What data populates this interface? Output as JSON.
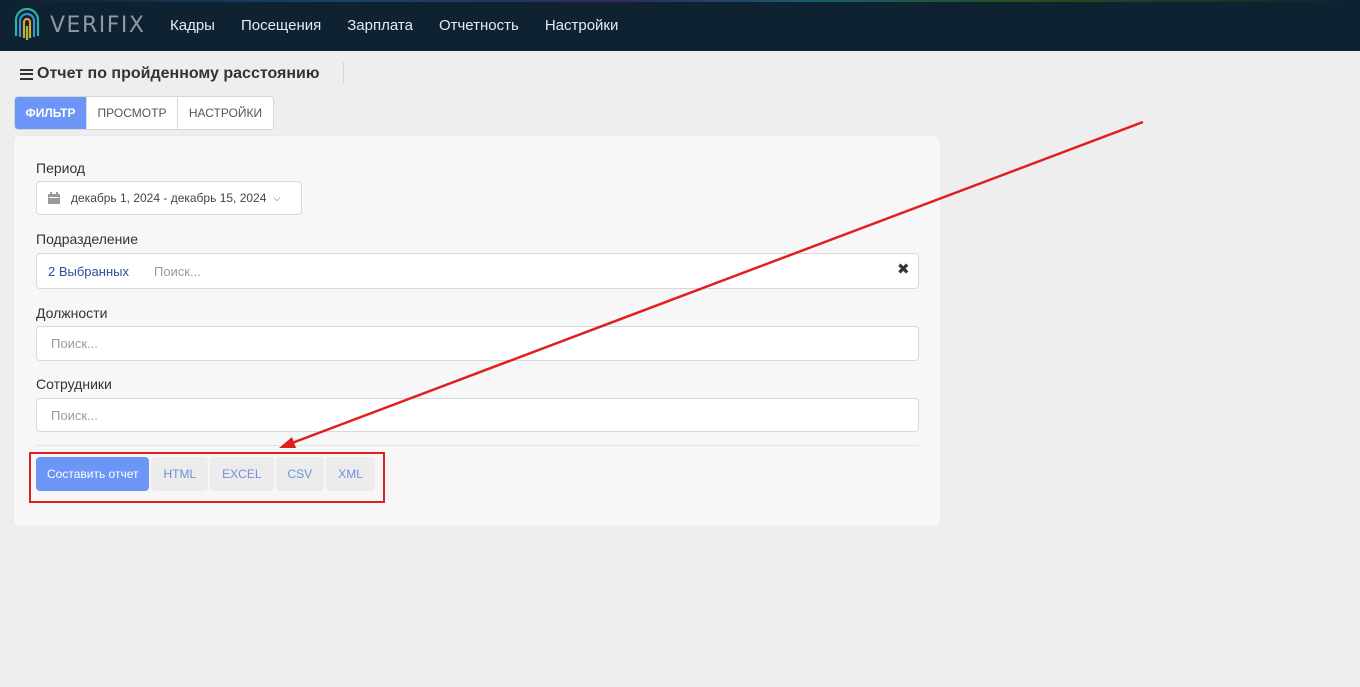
{
  "app": {
    "logo_text": "VERIFIX"
  },
  "nav": {
    "items": [
      {
        "label": "Кадры"
      },
      {
        "label": "Посещения"
      },
      {
        "label": "Зарплата"
      },
      {
        "label": "Отчетность"
      },
      {
        "label": "Настройки"
      }
    ]
  },
  "page": {
    "title": "Отчет по пройденному расстоянию"
  },
  "tabs": [
    {
      "label": "ФИЛЬТР",
      "active": true
    },
    {
      "label": "ПРОСМОТР",
      "active": false
    },
    {
      "label": "НАСТРОЙКИ",
      "active": false
    }
  ],
  "filter": {
    "period": {
      "label": "Период",
      "value": "декабрь 1, 2024 - декабрь 15, 2024",
      "icon": "calendar-icon"
    },
    "division": {
      "label": "Подразделение",
      "selected_text": "2 Выбранных",
      "placeholder": "Поиск...",
      "clear_icon": "close-icon"
    },
    "positions": {
      "label": "Должности",
      "placeholder": "Поиск..."
    },
    "employees": {
      "label": "Сотрудники",
      "placeholder": "Поиск..."
    }
  },
  "actions": {
    "build_label": "Составить отчет",
    "formats": [
      "HTML",
      "EXCEL",
      "CSV",
      "XML"
    ]
  },
  "colors": {
    "accent": "#6c96f5",
    "topbar": "#0e2231",
    "annotation": "#e02020"
  }
}
